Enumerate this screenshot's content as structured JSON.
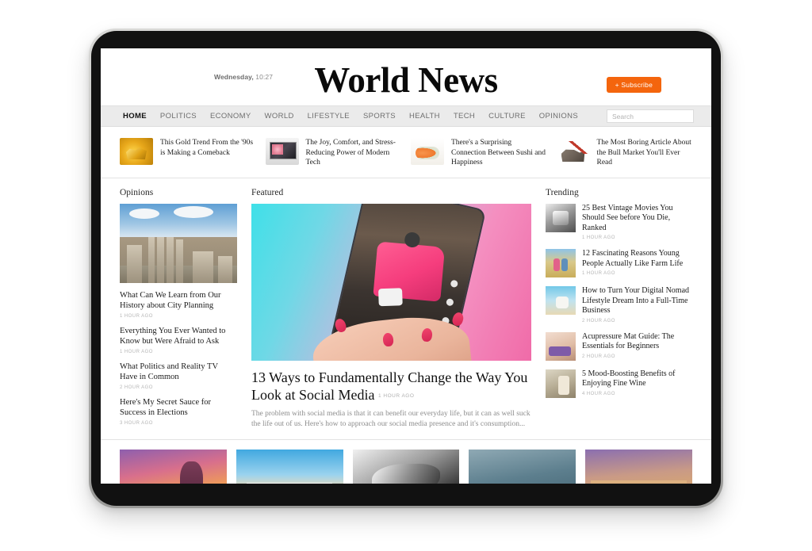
{
  "site": {
    "logo": "World News",
    "datetime_day": "Wednesday,",
    "datetime_time": "10:27",
    "subscribe_label": "+ Subscribe"
  },
  "nav": {
    "items": [
      {
        "label": "HOME",
        "active": true
      },
      {
        "label": "POLITICS",
        "active": false
      },
      {
        "label": "ECONOMY",
        "active": false
      },
      {
        "label": "WORLD",
        "active": false
      },
      {
        "label": "LIFESTYLE",
        "active": false
      },
      {
        "label": "SPORTS",
        "active": false
      },
      {
        "label": "HEALTH",
        "active": false
      },
      {
        "label": "TECH",
        "active": false
      },
      {
        "label": "CULTURE",
        "active": false
      },
      {
        "label": "OPINIONS",
        "active": false
      }
    ],
    "search_placeholder": "Search",
    "search_value": ""
  },
  "top_stories": [
    {
      "title": "This Gold Trend From the '90s is Making a Comeback",
      "image": "gold-bars-photo"
    },
    {
      "title": "The Joy, Comfort, and Stress-Reducing Power of Modern Tech",
      "image": "desktop-computer-photo"
    },
    {
      "title": "There's a Surprising Connection Between Sushi and Happiness",
      "image": "sushi-photo"
    },
    {
      "title": "The Most Boring Article About the Bull Market You'll Ever Read",
      "image": "bull-market-chart-photo"
    }
  ],
  "opinions": {
    "heading": "Opinions",
    "hero_image": "roman-forum-ruins-photo",
    "articles": [
      {
        "title": "What Can We Learn from Our History about City Planning",
        "time": "1 HOUR AGO"
      },
      {
        "title": "Everything You Ever Wanted to Know but Were Afraid to Ask",
        "time": "1 HOUR AGO"
      },
      {
        "title": "What Politics and Reality TV Have in Common",
        "time": "2 HOUR AGO"
      },
      {
        "title": "Here's My Secret Sauce for Success in Elections",
        "time": "3 HOUR AGO"
      }
    ]
  },
  "featured": {
    "heading": "Featured",
    "image": "hand-holding-phone-social-video-photo",
    "title": "13 Ways to Fundamentally Change the Way You Look at Social Media",
    "time": "1 HOUR AGO",
    "excerpt": "The problem with social media is that it can benefit our everyday life, but it can as well suck the life out of us. Here's how to approach our social media presence and it's consumption..."
  },
  "trending": {
    "heading": "Trending",
    "items": [
      {
        "title": "25 Best Vintage Movies You Should See before You Die, Ranked",
        "time": "1 HOUR AGO",
        "image": "vintage-movie-photo"
      },
      {
        "title": "12 Fascinating Reasons Young People Actually Like Farm Life",
        "time": "1 HOUR AGO",
        "image": "farm-couple-photo"
      },
      {
        "title": "How to Turn Your Digital Nomad Lifestyle Dream Into a Full-Time Business",
        "time": "2 HOUR AGO",
        "image": "beach-laptop-photo"
      },
      {
        "title": "Acupressure Mat Guide: The Essentials for Beginners",
        "time": "2 HOUR AGO",
        "image": "acupressure-mat-photo"
      },
      {
        "title": "5 Mood-Boosting Benefits of Enjoying Fine Wine",
        "time": "4 HOUR AGO",
        "image": "wine-tasting-photo"
      }
    ]
  },
  "gallery": [
    {
      "image": "sunset-silhouette-photo"
    },
    {
      "image": "santorini-coast-photo"
    },
    {
      "image": "aerial-waves-photo"
    },
    {
      "image": "blue-water-texture-photo"
    },
    {
      "image": "cityscape-photo"
    }
  ]
}
